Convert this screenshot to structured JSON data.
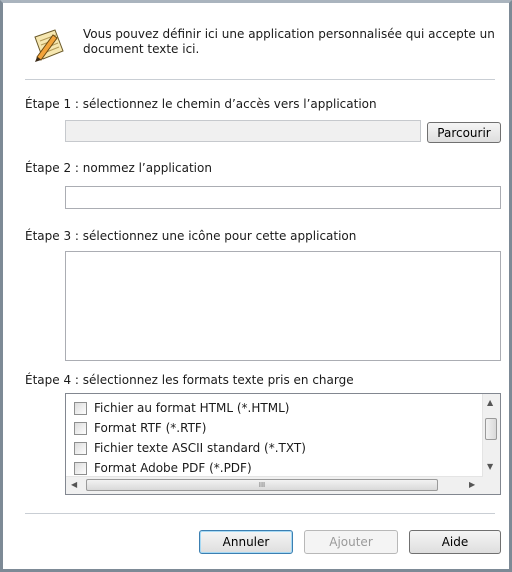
{
  "header": {
    "intro_text": "Vous pouvez définir ici une application personnalisée qui accepte un document texte ici.",
    "icon": "notepad-pencil-icon"
  },
  "step1": {
    "label": "Étape 1 : sélectionnez le chemin d’accès vers l’application",
    "path_value": "",
    "browse_label": "Parcourir"
  },
  "step2": {
    "label": "Étape 2 : nommez l’application",
    "name_value": ""
  },
  "step3": {
    "label": "Étape 3 : sélectionnez une icône pour cette application"
  },
  "step4": {
    "label": "Étape 4 : sélectionnez les formats texte pris en charge",
    "formats": [
      "Fichier au format HTML (*.HTML)",
      "Format RTF (*.RTF)",
      "Fichier texte ASCII standard (*.TXT)",
      "Format Adobe PDF (*.PDF)"
    ],
    "scroll_grip": "III"
  },
  "footer": {
    "cancel_label": "Annuler",
    "add_label": "Ajouter",
    "help_label": "Aide"
  }
}
